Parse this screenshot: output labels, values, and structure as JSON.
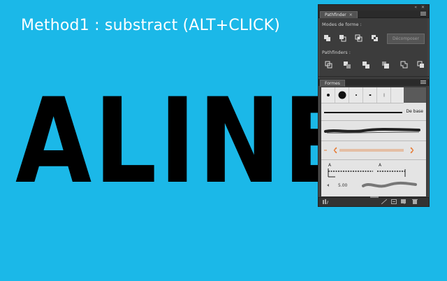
{
  "caption": "Method1 : substract (ALT+CLICK)",
  "big_word": "ALINE",
  "colors": {
    "background": "#1bb8e8",
    "panel": "#3c3c3c",
    "brush_bg": "#e4e4e4",
    "accent_orange": "#e67e3a"
  },
  "panel": {
    "topbar_glyphs": "«  ✕",
    "pathfinder_tab": "Pathfinder",
    "pathfinder_tab_close": "✕",
    "shape_modes_label": "Modes de forme :",
    "pathfinders_label": "Pathfinders :",
    "expand_button": "Décomposer",
    "shape_mode_icons": [
      "unite-icon",
      "minus-front-icon",
      "intersect-icon",
      "exclude-icon"
    ],
    "pathfinder_icons": [
      "divide-icon",
      "trim-icon",
      "merge-icon",
      "crop-icon",
      "outline-icon",
      "minus-back-icon"
    ],
    "brushes_tab": "Formes",
    "basic_brush_label": "De base",
    "scatter_size_label": "5.00",
    "bottom_icons": [
      "brush-library-icon",
      "remove-stroke-icon",
      "options-icon",
      "new-brush-icon",
      "delete-icon"
    ]
  }
}
